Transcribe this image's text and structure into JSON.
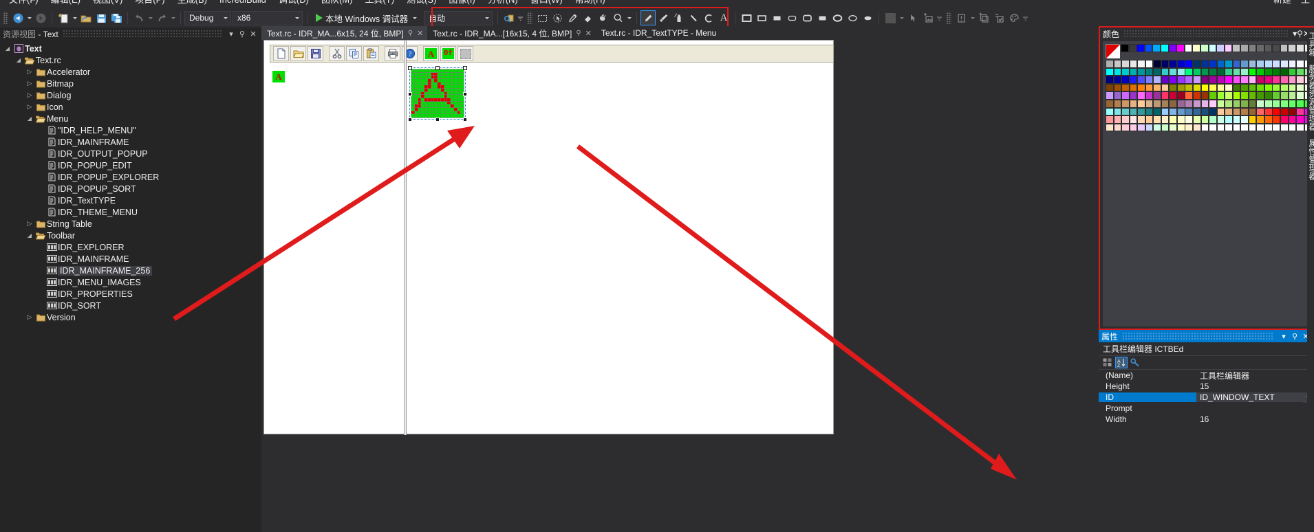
{
  "window": {
    "menu_items": [
      "文件(F)",
      "编辑(E)",
      "视图(V)",
      "项目(P)",
      "生成(B)",
      "IncrediBuild",
      "调试(D)",
      "团队(M)",
      "工具(T)",
      "测试(S)",
      "图像(I)",
      "分析(N)",
      "窗口(W)",
      "帮助(H)"
    ],
    "right_items": [
      "新建",
      "王"
    ]
  },
  "toolbar": {
    "config": "Debug",
    "platform": "x86",
    "run_label": "本地 Windows 调试器",
    "auto_label": "自动",
    "icons": [
      "navigate-back-icon",
      "navigate-forward-icon",
      "new-item-icon",
      "open-file-icon",
      "save-icon",
      "save-all-icon",
      "undo-icon",
      "redo-icon"
    ],
    "image_tools": [
      "find-resource-icon",
      "rect-select-icon",
      "magic-wand-icon",
      "color-picker-icon",
      "eraser-icon",
      "fill-icon",
      "zoom-icon",
      "pencil-icon",
      "brush-icon",
      "airbrush-icon",
      "line-icon",
      "curve-icon",
      "text-icon",
      "rect-outline-icon",
      "rect-filled-outline-icon",
      "rect-filled-icon",
      "rounded-rect-icon",
      "rounded-rect-outline-icon",
      "rounded-rect-filled-icon",
      "ellipse-icon",
      "ellipse-outline-icon",
      "ellipse-filled-icon"
    ],
    "selected_tool": "pencil-icon",
    "right_icons": [
      "transparent-bg-icon",
      "pointer-icon",
      "new-image-icon",
      "error-list-icon",
      "new-window-icon",
      "refresh-icon",
      "palette-icon"
    ]
  },
  "resource_view": {
    "title_prefix": "资源视图",
    "title_sep": " - ",
    "title_name": "Text",
    "tree": [
      {
        "label": "Text",
        "depth": 0,
        "icon": "solution-icon",
        "twisty": "open",
        "bold": true
      },
      {
        "label": "Text.rc",
        "depth": 1,
        "icon": "open-folder-icon",
        "twisty": "open"
      },
      {
        "label": "Accelerator",
        "depth": 2,
        "icon": "folder-icon",
        "twisty": "closed"
      },
      {
        "label": "Bitmap",
        "depth": 2,
        "icon": "folder-icon",
        "twisty": "closed"
      },
      {
        "label": "Dialog",
        "depth": 2,
        "icon": "folder-icon",
        "twisty": "closed"
      },
      {
        "label": "Icon",
        "depth": 2,
        "icon": "folder-icon",
        "twisty": "closed"
      },
      {
        "label": "Menu",
        "depth": 2,
        "icon": "open-folder-icon",
        "twisty": "open"
      },
      {
        "label": "\"IDR_HELP_MENU\"",
        "depth": 3,
        "icon": "resource-icon",
        "twisty": "none"
      },
      {
        "label": "IDR_MAINFRAME",
        "depth": 3,
        "icon": "resource-icon",
        "twisty": "none"
      },
      {
        "label": "IDR_OUTPUT_POPUP",
        "depth": 3,
        "icon": "resource-icon",
        "twisty": "none"
      },
      {
        "label": "IDR_POPUP_EDIT",
        "depth": 3,
        "icon": "resource-icon",
        "twisty": "none"
      },
      {
        "label": "IDR_POPUP_EXPLORER",
        "depth": 3,
        "icon": "resource-icon",
        "twisty": "none"
      },
      {
        "label": "IDR_POPUP_SORT",
        "depth": 3,
        "icon": "resource-icon",
        "twisty": "none"
      },
      {
        "label": "IDR_TextTYPE",
        "depth": 3,
        "icon": "resource-icon",
        "twisty": "none"
      },
      {
        "label": "IDR_THEME_MENU",
        "depth": 3,
        "icon": "resource-icon",
        "twisty": "none"
      },
      {
        "label": "String Table",
        "depth": 2,
        "icon": "folder-icon",
        "twisty": "closed"
      },
      {
        "label": "Toolbar",
        "depth": 2,
        "icon": "open-folder-icon",
        "twisty": "open"
      },
      {
        "label": "IDR_EXPLORER",
        "depth": 3,
        "icon": "toolbar-icon",
        "twisty": "none"
      },
      {
        "label": "IDR_MAINFRAME",
        "depth": 3,
        "icon": "toolbar-icon",
        "twisty": "none"
      },
      {
        "label": "IDR_MAINFRAME_256",
        "depth": 3,
        "icon": "toolbar-icon",
        "twisty": "none",
        "selected": true
      },
      {
        "label": "IDR_MENU_IMAGES",
        "depth": 3,
        "icon": "toolbar-icon",
        "twisty": "none"
      },
      {
        "label": "IDR_PROPERTIES",
        "depth": 3,
        "icon": "toolbar-icon",
        "twisty": "none"
      },
      {
        "label": "IDR_SORT",
        "depth": 3,
        "icon": "toolbar-icon",
        "twisty": "none"
      },
      {
        "label": "Version",
        "depth": 2,
        "icon": "folder-icon",
        "twisty": "closed"
      }
    ]
  },
  "tabs": [
    {
      "label": "Text.rc - IDR_MA...6x15, 24 位, BMP]",
      "active": true,
      "closable": true
    },
    {
      "label": "Text.rc - IDR_MA...[16x15, 4 位, BMP]",
      "active": false,
      "closable": true
    },
    {
      "label": "Text.rc - IDR_TextTYPE - Menu",
      "active": false,
      "closable": false
    }
  ],
  "editor": {
    "preview_toolbar_buttons": [
      "new-doc-icon",
      "open-folder-icon",
      "save-disk-icon",
      "cut-icon",
      "copy-icon",
      "paste-icon",
      "print-icon",
      "help-icon",
      "letter-a-green-icon",
      "glyph-icon",
      "empty-button-icon"
    ],
    "mini_glyph": "A",
    "magnified_glyph": "A"
  },
  "color_panel": {
    "title": "颜色",
    "accent": "#e01b1b",
    "current_fg": "#e00000",
    "current_bg": "#ffffff",
    "rows": [
      [
        "#000000",
        "#3a3a3a",
        "#0000ff",
        "#0055ff",
        "#00aaff",
        "#00ffff",
        "#7f00ff",
        "#ff00ff",
        "#ffffff",
        "#ffffcc",
        "#ccffcc",
        "#ccffff",
        "#ccccff",
        "#ffccff",
        "#c0c0c0",
        "#a9a9a9",
        "#808080",
        "#696969",
        "#5a5a5a",
        "#4a4a4a",
        "#bfbfbf",
        "#d0d0d0",
        "#e0e0e0",
        "#efefef",
        "#ffffff"
      ],
      [
        "#b0b0b0",
        "#c8c8c8",
        "#d8d8d8",
        "#e8e8e8",
        "#f4f4f4",
        "#ffffff",
        "#000033",
        "#000066",
        "#000099",
        "#0000cc",
        "#0000ff",
        "#003366",
        "#003399",
        "#0033cc",
        "#0066cc",
        "#0099cc",
        "#3366cc",
        "#6699cc",
        "#99bbdd",
        "#aaccee",
        "#bbddff",
        "#ccddff",
        "#dde8ff",
        "#eef2ff",
        "#f7f9ff",
        "#ffffff"
      ],
      [
        "#00ffff",
        "#00e5e5",
        "#00cccc",
        "#00b2b2",
        "#009999",
        "#008080",
        "#006666",
        "#33cccc",
        "#66dddd",
        "#99eeee",
        "#00ff80",
        "#00cc66",
        "#009950",
        "#00803f",
        "#006633",
        "#33cc88",
        "#66ddaa",
        "#99eecc",
        "#00ff00",
        "#00cc00",
        "#009900",
        "#008000",
        "#006600",
        "#33cc33",
        "#66dd66",
        "#99ee99"
      ],
      [
        "#000080",
        "#0000a0",
        "#0000c0",
        "#1a1aff",
        "#4d4dff",
        "#8080ff",
        "#b3b3ff",
        "#6600cc",
        "#7f00ff",
        "#9933ff",
        "#b366ff",
        "#cc99ff",
        "#800080",
        "#a000a0",
        "#c000c0",
        "#ff00ff",
        "#ff4dff",
        "#ff80ff",
        "#ffb3ff",
        "#cc0066",
        "#e6007f",
        "#ff3399",
        "#ff66b2",
        "#ff99cc",
        "#ffccdd",
        "#ffe6ee"
      ],
      [
        "#804000",
        "#a05000",
        "#c06000",
        "#e07000",
        "#ff8000",
        "#ff9933",
        "#ffb366",
        "#ffcc99",
        "#808000",
        "#a0a000",
        "#c0c000",
        "#e0e000",
        "#ffff00",
        "#ffff4d",
        "#ffff99",
        "#ffffcc",
        "#408000",
        "#50a000",
        "#60c000",
        "#70e000",
        "#80ff00",
        "#99ff33",
        "#b3ff66",
        "#ccff99",
        "#e6ffcc",
        "#f2ffe6"
      ],
      [
        "#cc99ff",
        "#9966cc",
        "#cc66ff",
        "#9933cc",
        "#ff66ff",
        "#cc33cc",
        "#993399",
        "#ff3366",
        "#cc0033",
        "#990022",
        "#ff6633",
        "#cc3300",
        "#993300",
        "#66cc00",
        "#99ff33",
        "#ccff66",
        "#aaff00",
        "#88dd00",
        "#66bb00",
        "#449900",
        "#338800",
        "#66cc33",
        "#99dd66",
        "#bbee99",
        "#ddffcc",
        "#eeffe6"
      ],
      [
        "#996633",
        "#b3814d",
        "#cc9966",
        "#e6b380",
        "#ffcc99",
        "#d9b38c",
        "#bf9973",
        "#a68059",
        "#8c6640",
        "#996699",
        "#b380b3",
        "#cc99cc",
        "#e6b3e6",
        "#ffccff",
        "#ccff99",
        "#b3e680",
        "#99cc66",
        "#80b34d",
        "#668033",
        "#ccffcc",
        "#b3ffb3",
        "#99ff99",
        "#80ff80",
        "#66ff66",
        "#4dff4d",
        "#33ff33"
      ],
      [
        "#99ffff",
        "#80e6e6",
        "#66cccc",
        "#4db3b3",
        "#339999",
        "#1a8080",
        "#006666",
        "#99ccff",
        "#80b3e6",
        "#6699cc",
        "#4d80b3",
        "#336699",
        "#1a4d80",
        "#003366",
        "#ffcc99",
        "#e6b380",
        "#cc9966",
        "#b3804d",
        "#996633",
        "#ff6666",
        "#ff3333",
        "#ff0000",
        "#cc0000",
        "#990000",
        "#ff3399",
        "#ff00ff"
      ],
      [
        "#ff9999",
        "#ffb3b3",
        "#ffcccc",
        "#ffe6e6",
        "#ffd9b3",
        "#ffcc99",
        "#ffe0b3",
        "#fff0cc",
        "#ffffb3",
        "#ffffcc",
        "#ffffe6",
        "#e6ffb3",
        "#ccff99",
        "#b3ffcc",
        "#ccffe6",
        "#b3ffff",
        "#ccffff",
        "#e6ffff",
        "#ffcc00",
        "#ff9900",
        "#ff6600",
        "#ff3300",
        "#ff0066",
        "#ff0099",
        "#ff00cc",
        "#ff00ff"
      ],
      [
        "#ffe6cc",
        "#ffd9cc",
        "#ffccd9",
        "#ffcce6",
        "#e6ccff",
        "#ccd9ff",
        "#ccffe6",
        "#ccffcc",
        "#e6ffcc",
        "#ffffcc",
        "#fff2cc",
        "#ffe6cc",
        "#ffffff",
        "#ffffff",
        "#ffffff",
        "#ffffff",
        "#ffffff",
        "#ffffff",
        "#ffffff",
        "#ffffff",
        "#ffffff",
        "#ffffff",
        "#ffffff",
        "#ffffff",
        "#ffffff",
        "#ffffff"
      ]
    ]
  },
  "properties": {
    "title": "属性",
    "object_name": "工具栏编辑器 ICTBEd",
    "toolbar_icons": [
      "categorized-icon",
      "alphabetical-icon",
      "properties-icon"
    ],
    "rows": [
      {
        "key": "(Name)",
        "value": "工具栏编辑器",
        "selected": false
      },
      {
        "key": "Height",
        "value": "15",
        "selected": false
      },
      {
        "key": "ID",
        "value": "ID_WINDOW_TEXT",
        "selected": true,
        "dropdown": true
      },
      {
        "key": "Prompt",
        "value": "",
        "selected": false
      },
      {
        "key": "Width",
        "value": "16",
        "selected": false
      }
    ]
  },
  "vertical_tabs": [
    "工具箱",
    "服务器资源管理器",
    "属性管理器"
  ]
}
